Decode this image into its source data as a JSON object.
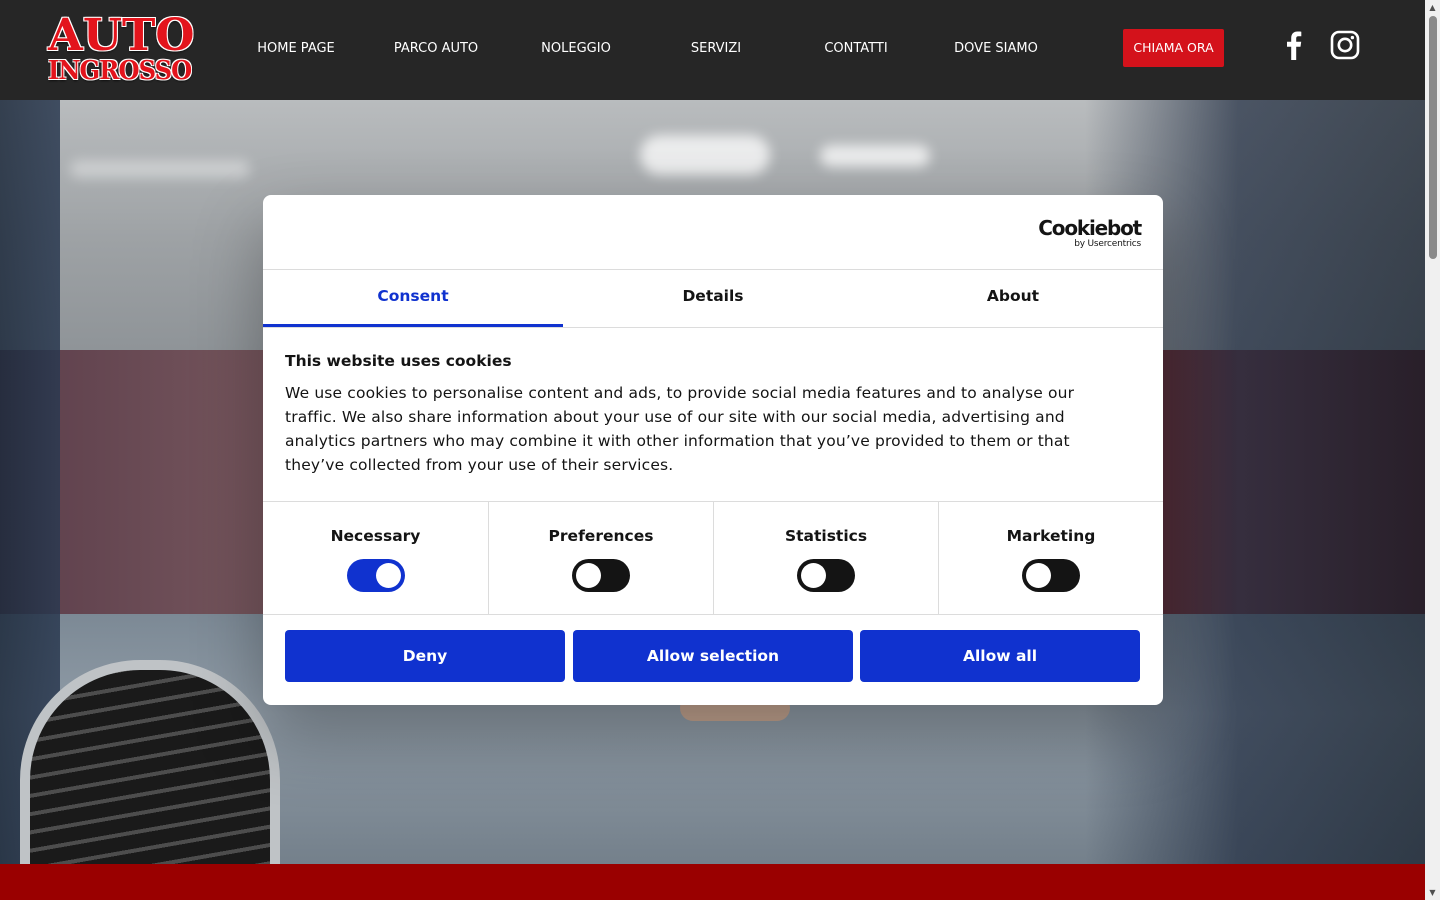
{
  "brand": {
    "logo_line1": "AUTO",
    "logo_line2": "INGROSSO",
    "logo_color": "#e3141c"
  },
  "nav": {
    "items": [
      {
        "label": "HOME PAGE"
      },
      {
        "label": "PARCO AUTO"
      },
      {
        "label": "NOLEGGIO"
      },
      {
        "label": "SERVIZI"
      },
      {
        "label": "CONTATTI"
      },
      {
        "label": "DOVE SIAMO"
      }
    ],
    "cta_label": "CHIAMA ORA",
    "cta_color": "#d4121b",
    "social_icons": [
      "facebook-icon",
      "instagram-icon"
    ]
  },
  "cookie_dialog": {
    "provider_logo": "Cookiebot",
    "provider_sub": "by Usercentrics",
    "tabs": [
      {
        "label": "Consent",
        "active": true
      },
      {
        "label": "Details",
        "active": false
      },
      {
        "label": "About",
        "active": false
      }
    ],
    "title": "This website uses cookies",
    "body": "We use cookies to personalise content and ads, to provide social media features and to analyse our traffic. We also share information about your use of our site with our social media, advertising and analytics partners who may combine it with other information that you’ve provided to them or that they’ve collected from your use of their services.",
    "categories": [
      {
        "label": "Necessary",
        "enabled": true
      },
      {
        "label": "Preferences",
        "enabled": false
      },
      {
        "label": "Statistics",
        "enabled": false
      },
      {
        "label": "Marketing",
        "enabled": false
      }
    ],
    "buttons": {
      "deny": "Deny",
      "allow_selection": "Allow selection",
      "allow_all": "Allow all"
    },
    "accent_color": "#1032cf"
  },
  "colors": {
    "header_bg": "#262626",
    "footer_strip": "#9a0000"
  }
}
